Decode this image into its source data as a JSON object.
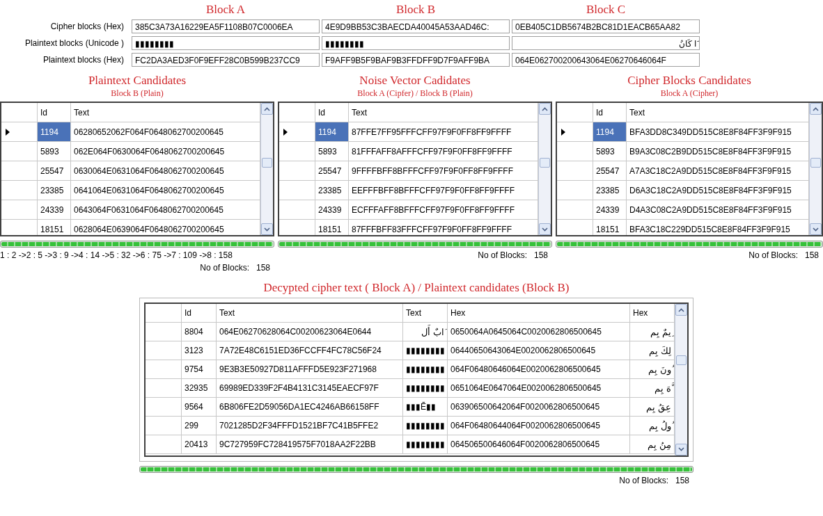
{
  "blocks": {
    "headings": [
      "Block A",
      "Block B",
      "Block C"
    ],
    "rows": [
      {
        "label": "Cipher blocks (Hex)",
        "values": [
          "385C3A73A16229EA5F1108B07C0006EA",
          "4E9D9BB53C3BAECDA40045A53AAD46C:",
          "0EB405C1DB5674B2BC81D1EACB65AA82"
        ]
      },
      {
        "label": "Plaintext blocks (Unicode )",
        "values": [
          "▮▮▮▮▮▮▮▮",
          "▮▮▮▮▮▮▮▮",
          "َا كَانُ"
        ]
      },
      {
        "label": "Plaintext blocks (Hex)",
        "values": [
          "FC2DA3AED3F0F9EFF28C0B599B237CC9",
          "F9AFF9B5F9BAF9B3FFDFF9D7F9AFF9BA",
          "064E062700200643064E06270646064F"
        ]
      }
    ]
  },
  "panels": [
    {
      "title": "Plaintext Candidates",
      "subtitle": "Block B (Plain)",
      "columns": [
        "Id",
        "Text"
      ],
      "rows": [
        {
          "selected": true,
          "cells": [
            "1194",
            "06280652062F064F0648062700200645"
          ]
        },
        {
          "selected": false,
          "cells": [
            "5893",
            "062E064F0630064F0648062700200645"
          ]
        },
        {
          "selected": false,
          "cells": [
            "25547",
            "0630064E0631064F0648062700200645"
          ]
        },
        {
          "selected": false,
          "cells": [
            "23385",
            "0641064E0631064F0648062700200645"
          ]
        },
        {
          "selected": false,
          "cells": [
            "24339",
            "0643064F0631064F0648062700200645"
          ]
        },
        {
          "selected": false,
          "cells": [
            "18151",
            "0628064E0639064F0648062700200645"
          ]
        }
      ],
      "progress": {
        "level": 1
      },
      "sequence": "1 : 2 ->2 : 5 ->3 : 9 ->4 : 14 ->5 : 32 ->6 : 75 ->7 : 109 ->8 : 158",
      "count_label": "No of Blocks:",
      "count": "158"
    },
    {
      "title": "Noise Vector Cadidates",
      "subtitle": "Block A (Cipfer) / Block B (Plain)",
      "columns": [
        "Id",
        "Text"
      ],
      "rows": [
        {
          "selected": true,
          "cells": [
            "1194",
            "87FFE7FF95FFFCFF97F9F0FF8FF9FFFF"
          ]
        },
        {
          "selected": false,
          "cells": [
            "5893",
            "81FFFAFF8AFFFCFF97F9F0FF8FF9FFFF"
          ]
        },
        {
          "selected": false,
          "cells": [
            "25547",
            "9FFFFBFF8BFFFCFF97F9F0FF8FF9FFFF"
          ]
        },
        {
          "selected": false,
          "cells": [
            "23385",
            "EEFFFBFF8BFFFCFF97F9F0FF8FF9FFFF"
          ]
        },
        {
          "selected": false,
          "cells": [
            "24339",
            "ECFFFAFF8BFFFCFF97F9F0FF8FF9FFFF"
          ]
        },
        {
          "selected": false,
          "cells": [
            "18151",
            "87FFFBFF83FFFCFF97F9F0FF8FF9FFFF"
          ]
        }
      ],
      "progress": {
        "level": 1
      },
      "count_label": "No of Blocks:",
      "count": "158"
    },
    {
      "title": "Cipher Blocks Candidates",
      "subtitle": "Block A (Cipher)",
      "columns": [
        "Id",
        "Text"
      ],
      "rows": [
        {
          "selected": true,
          "cells": [
            "1194",
            "BFA3DD8C349DD515C8E8F84FF3F9F915"
          ]
        },
        {
          "selected": false,
          "cells": [
            "5893",
            "B9A3C08C2B9DD515C8E8F84FF3F9F915"
          ]
        },
        {
          "selected": false,
          "cells": [
            "25547",
            "A7A3C18C2A9DD515C8E8F84FF3F9F915"
          ]
        },
        {
          "selected": false,
          "cells": [
            "23385",
            "D6A3C18C2A9DD515C8E8F84FF3F9F915"
          ]
        },
        {
          "selected": false,
          "cells": [
            "24339",
            "D4A3C08C2A9DD515C8E8F84FF3F9F915"
          ]
        },
        {
          "selected": false,
          "cells": [
            "18151",
            "BFA3C18C229DD515C8E8F84FF3F9F915"
          ]
        }
      ],
      "progress": {
        "level": 1
      },
      "count_label": "No of Blocks:",
      "count": "158"
    }
  ],
  "decrypted": {
    "title": "Decypted cipher text ( Block A) / Plaintext candidates (Block B)",
    "columns": [
      "Id",
      "Text",
      "Text",
      "Hex",
      "Hex"
    ],
    "rows": [
      {
        "selected": false,
        "cells": [
          "8804",
          "064E06270628064C00200623064E0644",
          "َابٌ أَل",
          "0650064A0645064C0020062806500645",
          "ِيمٌ بِم"
        ]
      },
      {
        "selected": false,
        "cells": [
          "3123",
          "7A72E48C6151ED36FCCFF4FC78C56F24",
          "▮▮▮▮▮▮▮▮",
          "06440650643064E0020062806500645",
          "لِكَ بِم"
        ]
      },
      {
        "selected": false,
        "cells": [
          "9754",
          "9E3B3E50927D811AFFFD5E923F271968",
          "▮▮▮▮▮▮▮▮",
          "064F06480646064E0020062806500645",
          "ُونَ بِم"
        ]
      },
      {
        "selected": false,
        "cells": [
          "32935",
          "69989ED339F2F4B4131C3145EAECF97F",
          "▮▮▮▮▮▮▮▮",
          "0651064E0647064E0020062806500645",
          "َّهَ بِم"
        ]
      },
      {
        "selected": false,
        "cells": [
          "9564",
          "6B806FE2D59056DA1EC4246AB66158FF",
          "▮▮▮Ẽ▮▮",
          "063906500642064F0020062806500645",
          "عِقُ بِم"
        ]
      },
      {
        "selected": false,
        "cells": [
          "299",
          "7021285D2F34FFFD1521BF7C41B5FFE2",
          "▮▮▮▮▮▮▮▮",
          "064F06480644064F0020062806500645",
          "ُولُ بِم"
        ]
      },
      {
        "selected": false,
        "cells": [
          "20413",
          "9C727959FC728419575F7018AA2F22BB",
          "▮▮▮▮▮▮▮▮",
          "064506500646064F0020062806500645",
          "مِنُ بِم"
        ]
      }
    ],
    "progress": {
      "level": 1
    },
    "count_label": "No of Blocks:",
    "count": "158"
  }
}
